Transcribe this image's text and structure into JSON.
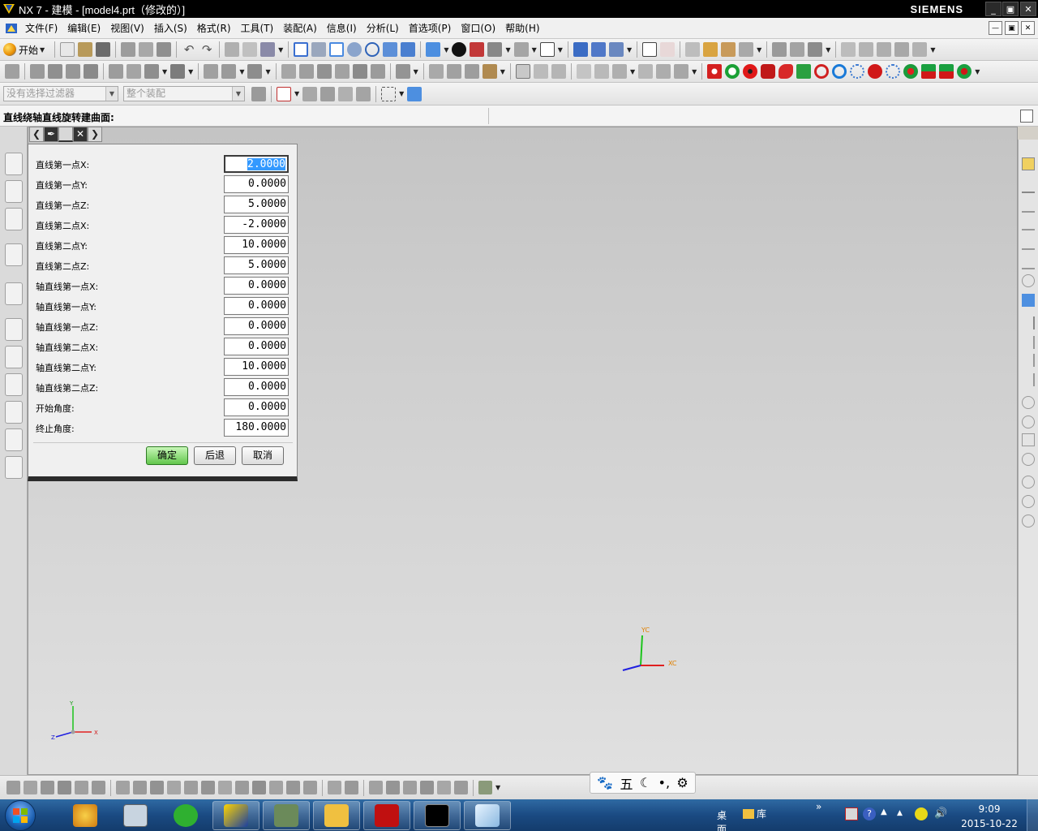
{
  "window": {
    "title": "NX 7 - 建模 - [model4.prt（修改的）]",
    "brand": "SIEMENS"
  },
  "menu": [
    "文件(F)",
    "编辑(E)",
    "视图(V)",
    "插入(S)",
    "格式(R)",
    "工具(T)",
    "装配(A)",
    "信息(I)",
    "分析(L)",
    "首选项(P)",
    "窗口(O)",
    "帮助(H)"
  ],
  "toolbar": {
    "start_label": "开始",
    "filter_placeholder": "没有选择过滤器",
    "assembly_scope": "整个装配"
  },
  "cue_line": "直线绕轴直线旋转建曲面:",
  "dialog": {
    "fields": [
      {
        "label": "直线第一点X:",
        "value": "2.0000"
      },
      {
        "label": "直线第一点Y:",
        "value": "0.0000"
      },
      {
        "label": "直线第一点Z:",
        "value": "5.0000"
      },
      {
        "label": "直线第二点X:",
        "value": "-2.0000"
      },
      {
        "label": "直线第二点Y:",
        "value": "10.0000"
      },
      {
        "label": "直线第二点Z:",
        "value": "5.0000"
      },
      {
        "label": "轴直线第一点X:",
        "value": "0.0000"
      },
      {
        "label": "轴直线第一点Y:",
        "value": "0.0000"
      },
      {
        "label": "轴直线第一点Z:",
        "value": "0.0000"
      },
      {
        "label": "轴直线第二点X:",
        "value": "0.0000"
      },
      {
        "label": "轴直线第二点Y:",
        "value": "10.0000"
      },
      {
        "label": "轴直线第二点Z:",
        "value": "0.0000"
      },
      {
        "label": "开始角度:",
        "value": "0.0000"
      },
      {
        "label": "终止角度:",
        "value": "180.0000"
      }
    ],
    "ok_label": "确定",
    "back_label": "后退",
    "cancel_label": "取消"
  },
  "triad_main": {
    "yc": "YC",
    "xc": "XC"
  },
  "triad_small": {
    "y": "Y",
    "x": "X",
    "z": "Z"
  },
  "ime": [
    "五"
  ],
  "taskbar": {
    "desktop": "桌面",
    "library": "库"
  },
  "clock": {
    "time": "9:09",
    "date": "2015-10-22"
  }
}
